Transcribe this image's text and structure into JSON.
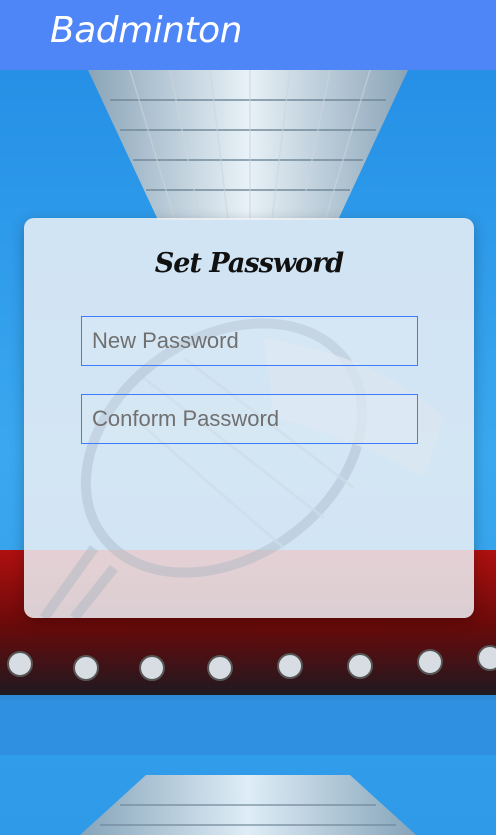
{
  "app_bar": {
    "title": "Badminton",
    "color": "#4f86f7"
  },
  "card": {
    "title": "Set Password",
    "new_password": {
      "value": "",
      "placeholder": "New Password"
    },
    "confirm_password": {
      "value": "",
      "placeholder": "Conform Password"
    }
  },
  "colors": {
    "field_border": "#3d7bff",
    "background_blue": "#2c8fe0"
  }
}
